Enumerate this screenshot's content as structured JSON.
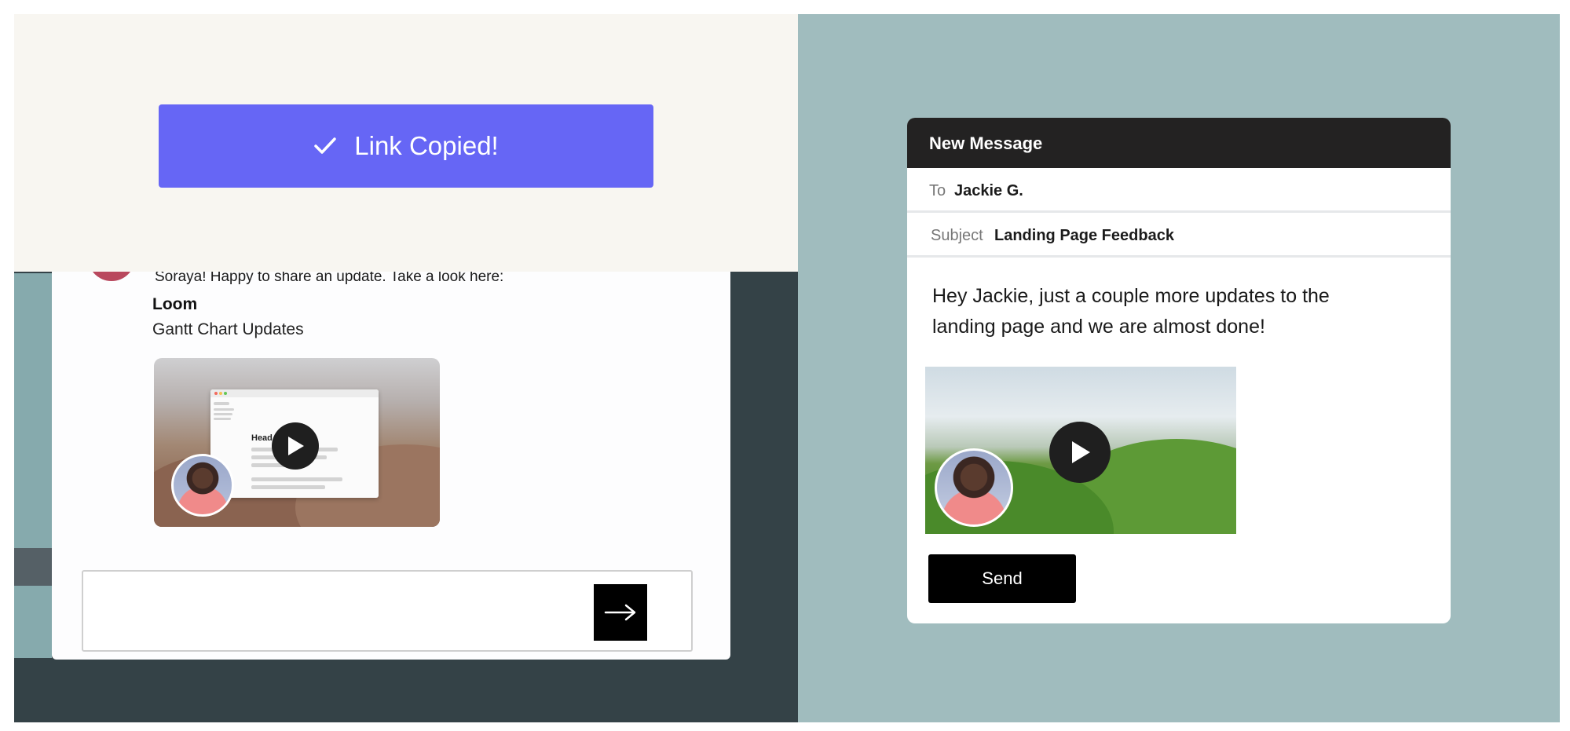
{
  "link_overlay": {
    "button_label": "Link Copied!",
    "icon": "checkmark-icon"
  },
  "chat": {
    "message": "Soraya! Happy to share an update. Take a look here:",
    "link_preview": {
      "app_name": "Loom",
      "title": "Gantt Chart Updates",
      "thumbnail_heading": "Head"
    },
    "input": {
      "value": "",
      "placeholder": ""
    },
    "send_icon": "arrow-right-icon"
  },
  "email": {
    "window_title": "New Message",
    "to_label": "To",
    "to_value": "Jackie G.",
    "subject_label": "Subject",
    "subject_value": "Landing Page Feedback",
    "body": "Hey Jackie, just a couple more updates to the landing page and we are almost done!",
    "send_label": "Send"
  },
  "colors": {
    "accent_purple": "#6666f5",
    "left_background": "#344247",
    "right_background": "#a0bcbe",
    "overlay_background": "#f8f6f1",
    "email_header": "#232222"
  }
}
